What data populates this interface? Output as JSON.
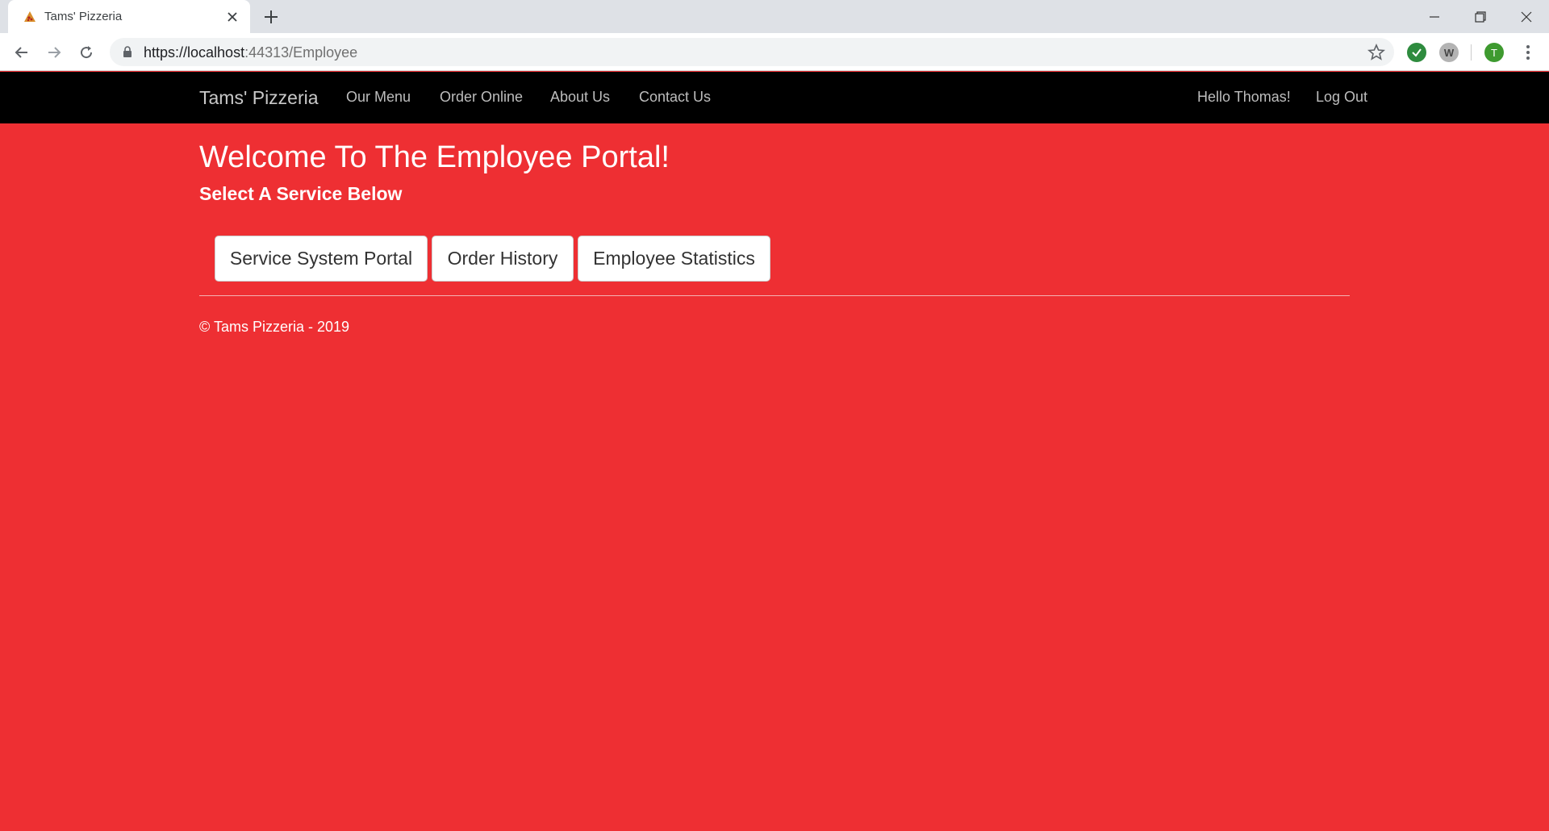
{
  "browser": {
    "tab_title": "Tams' Pizzeria",
    "url_host": "https://localhost",
    "url_rest": ":44313/Employee",
    "avatar_letter": "T",
    "extension_w_letter": "W"
  },
  "navbar": {
    "brand": "Tams' Pizzeria",
    "links": [
      "Our Menu",
      "Order Online",
      "About Us",
      "Contact Us"
    ],
    "greeting": "Hello Thomas!",
    "logout": "Log Out"
  },
  "main": {
    "title": "Welcome To The Employee Portal!",
    "subtitle": "Select A Service Below",
    "buttons": [
      "Service System Portal",
      "Order History",
      "Employee Statistics"
    ]
  },
  "footer": {
    "text": "© Tams Pizzeria - 2019"
  },
  "colors": {
    "page_background": "#ee2f33",
    "navbar_background": "#000000",
    "button_background": "#ffffff"
  }
}
